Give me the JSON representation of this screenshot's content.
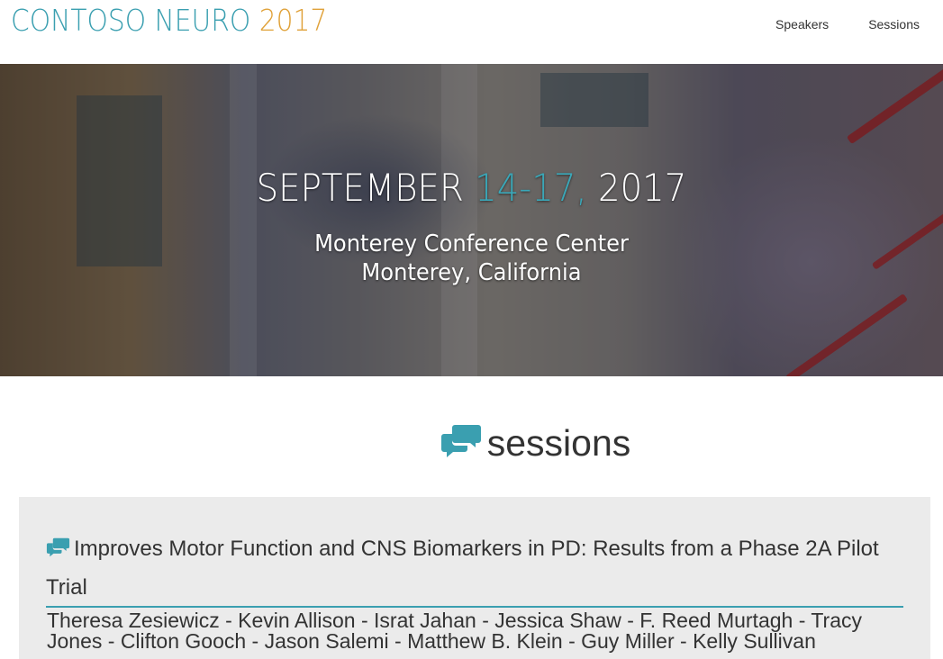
{
  "header": {
    "brand_name": "CONTOSO NEURO",
    "brand_year": "2017",
    "nav": [
      "Speakers",
      "Sessions"
    ]
  },
  "hero": {
    "date_prefix": "SEPTEMBER",
    "date_accent": "14-17,",
    "date_year": "2017",
    "venue_line1": "Monterey Conference Center",
    "venue_line2": "Monterey, California"
  },
  "sessions": {
    "heading": "sessions",
    "items": [
      {
        "title": "Improves Motor Function and CNS Biomarkers in PD: Results from a Phase 2A Pilot Trial",
        "authors": "Theresa Zesiewicz - Kevin Allison - Israt Jahan - Jessica Shaw - F. Reed Murtagh - Tracy Jones - Clifton Gooch - Jason Salemi - Matthew B. Klein - Guy Miller - Kelly Sullivan"
      }
    ]
  },
  "colors": {
    "accent_teal": "#3a9fb0",
    "accent_orange": "#e0a23a",
    "card_bg": "#ebebeb",
    "text": "#333333"
  },
  "icons": {
    "section": "speech-bubbles-icon",
    "session": "speech-bubbles-icon"
  }
}
